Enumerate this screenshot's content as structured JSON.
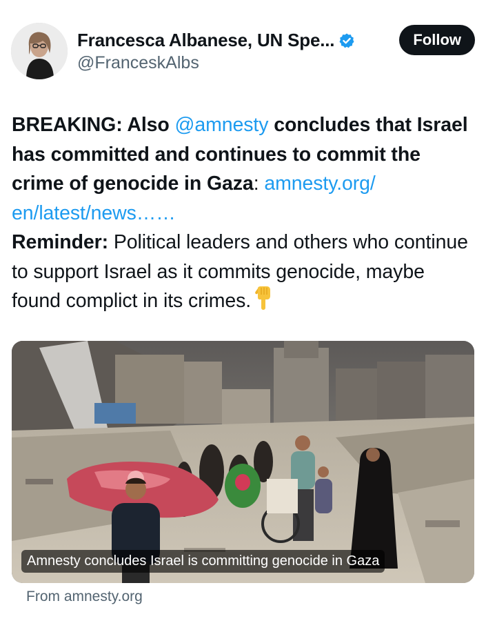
{
  "author": {
    "display_name": "Francesca Albanese, UN Spe...",
    "handle": "@FranceskAlbs",
    "verified_icon": "verified-badge-icon",
    "avatar_icon": "profile-photo"
  },
  "follow_label": "Follow",
  "tweet": {
    "p1_bold_a": "BREAKING: Also ",
    "p1_mention": "@amnesty",
    "p1_bold_b": " concludes that Israel has committed and continues to commit the crime of genocide in Gaza",
    "p1_colon": ": ",
    "p1_link": "amnesty.org/ en/latest/news……",
    "p2_bold": "Reminder:",
    "p2_text": " Political leaders and others who continue to support Israel as it commits genocide, maybe found complict in its crimes.",
    "emoji": "backhand-index-pointing-down-emoji"
  },
  "card": {
    "caption": "Amnesty concludes Israel is committing genocide in Gaza",
    "image": "photo of people walking through rubble of destroyed buildings",
    "source": "From amnesty.org"
  },
  "colors": {
    "link": "#1d9bf0",
    "follow_bg": "#0f1419",
    "secondary_text": "#536471",
    "verified": "#1d9bf0"
  }
}
